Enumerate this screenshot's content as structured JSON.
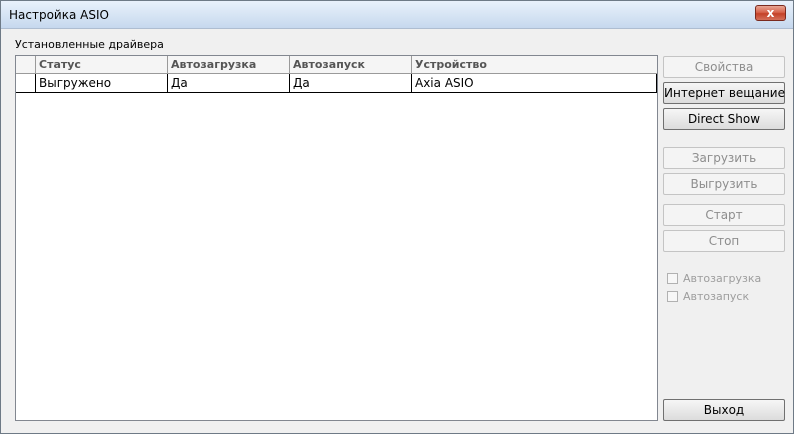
{
  "window": {
    "title": "Настройка ASIO",
    "close_glyph": "x"
  },
  "group": {
    "label": "Установленные драйвера"
  },
  "table": {
    "columns": [
      "Статус",
      "Автозагрузка",
      "Автозапуск",
      "Устройство"
    ],
    "rows": [
      [
        "Выгружено",
        "Да",
        "Да",
        "Axia ASIO"
      ]
    ]
  },
  "buttons": {
    "properties": "Свойства",
    "internet": "Интернет вещание",
    "directshow": "Direct Show",
    "load": "Загрузить",
    "unload": "Выгрузить",
    "start": "Старт",
    "stop": "Стоп",
    "exit": "Выход"
  },
  "checkboxes": {
    "autoload": {
      "label": "Автозагрузка",
      "checked": false,
      "enabled": false
    },
    "autostart": {
      "label": "Автозапуск",
      "checked": false,
      "enabled": false
    }
  }
}
